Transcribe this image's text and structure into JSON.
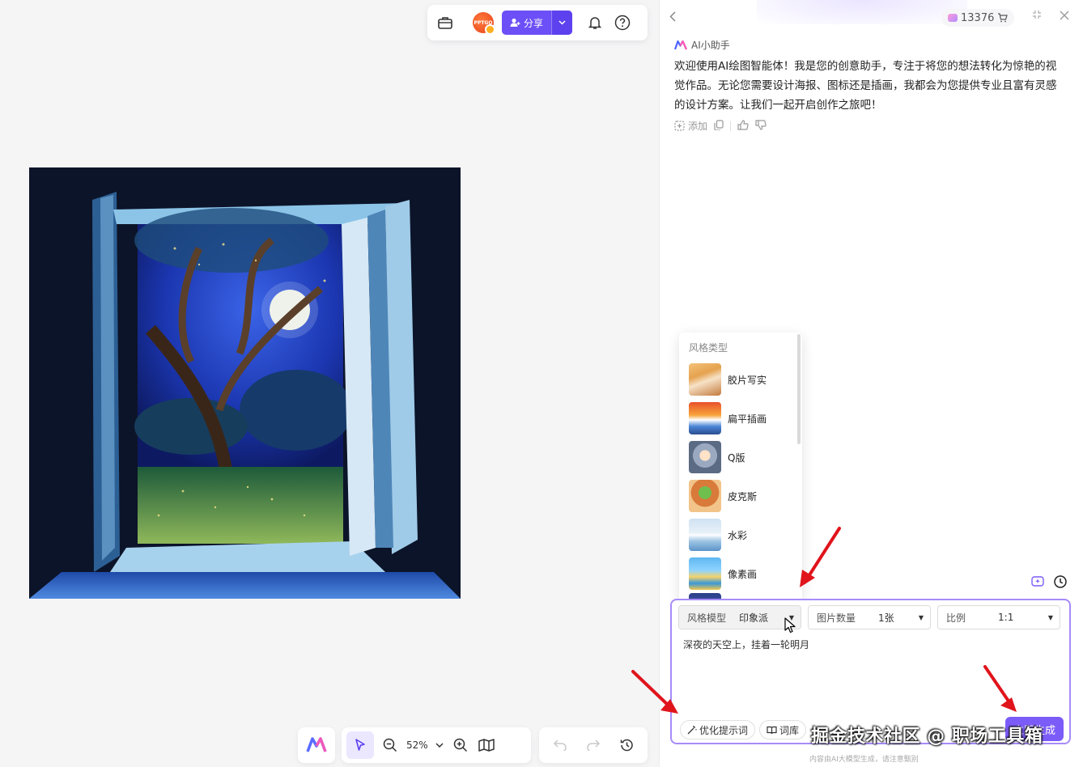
{
  "toolbar": {
    "toolbox_icon": "briefcase-icon",
    "avatar_text": "PPTGO",
    "share_label": "分享",
    "bell_icon": "bell-icon",
    "help_icon": "question-icon"
  },
  "artwork": {
    "description_icon": "generated-painting"
  },
  "bottom_bar": {
    "zoom_label": "52%"
  },
  "panel": {
    "credits": "13376",
    "assistant_name": "AI小助手",
    "message": "欢迎使用AI绘图智能体！我是您的创意助手，专注于将您的想法转化为惊艳的视觉作品。无论您需要设计海报、图标还是插画，我都会为您提供专业且富有灵感的设计方案。让我们一起开启创作之旅吧！",
    "add_label": "添加"
  },
  "style_menu": {
    "title": "风格类型",
    "items": [
      {
        "label": "胶片写实"
      },
      {
        "label": "扁平插画"
      },
      {
        "label": "Q版"
      },
      {
        "label": "皮克斯"
      },
      {
        "label": "水彩"
      },
      {
        "label": "像素画"
      }
    ]
  },
  "input": {
    "style_label": "风格模型",
    "style_value": "印象派",
    "count_label": "图片数量",
    "count_value": "1张",
    "ratio_label": "比例",
    "ratio_value": "1:1",
    "prompt": "深夜的天空上，挂着一轮明月",
    "optimize_label": "优化提示词",
    "lexicon_label": "词库",
    "generate_label": "立即生成"
  },
  "disclaimer": "内容由AI大模型生成，请注意甄别",
  "watermark": "掘金技术社区 @ 职场工具箱",
  "colors": {
    "accent": "#6c4ff6",
    "input_border": "#a78bfa",
    "arrow": "#e0141b"
  }
}
